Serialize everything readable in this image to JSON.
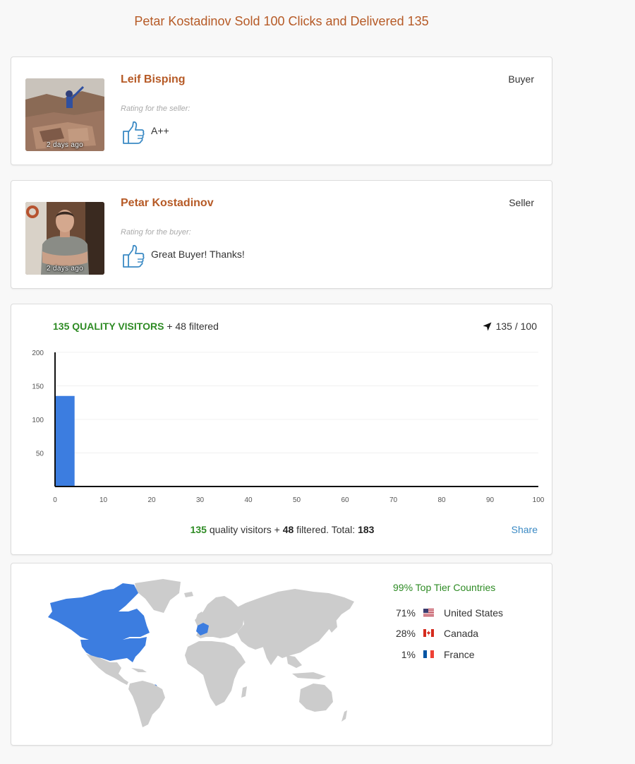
{
  "page": {
    "title": "Petar Kostadinov Sold 100 Clicks and Delivered 135"
  },
  "reviews": [
    {
      "name": "Leif Bisping",
      "role": "Buyer",
      "rating_label": "Rating for the seller:",
      "comment": "A++",
      "time_ago": "2 days ago",
      "icon": "thumbs-up-icon"
    },
    {
      "name": "Petar Kostadinov",
      "role": "Seller",
      "rating_label": "Rating for the buyer:",
      "comment": "Great Buyer! Thanks!",
      "time_ago": "2 days ago",
      "icon": "thumbs-up-icon"
    }
  ],
  "visitors": {
    "quality_label": "135 QUALITY VISITORS",
    "filtered_label": "+ 48 filtered",
    "delivered_ratio": "135 / 100",
    "summary": {
      "quality": "135",
      "quality_text": "quality visitors +",
      "filtered": "48",
      "filtered_text": "filtered. Total:",
      "total": "183"
    },
    "share_label": "Share"
  },
  "chart_data": {
    "type": "bar",
    "x": [
      2
    ],
    "values": [
      135
    ],
    "xlim": [
      0,
      100
    ],
    "ylim": [
      0,
      200
    ],
    "xticks": [
      0,
      10,
      20,
      30,
      40,
      50,
      60,
      70,
      80,
      90,
      100
    ],
    "yticks": [
      50,
      100,
      150,
      200
    ],
    "xlabel": "",
    "ylabel": "",
    "grid": true,
    "bar_color": "#3c7de0"
  },
  "geo": {
    "top_tier_label": "99% Top Tier Countries",
    "highlight_color": "#3c7de0",
    "base_color": "#cccccc",
    "countries": [
      {
        "pct": "71%",
        "name": "United States",
        "flag": "us-flag-icon"
      },
      {
        "pct": "28%",
        "name": "Canada",
        "flag": "ca-flag-icon"
      },
      {
        "pct": "1%",
        "name": "France",
        "flag": "fr-flag-icon"
      }
    ]
  }
}
